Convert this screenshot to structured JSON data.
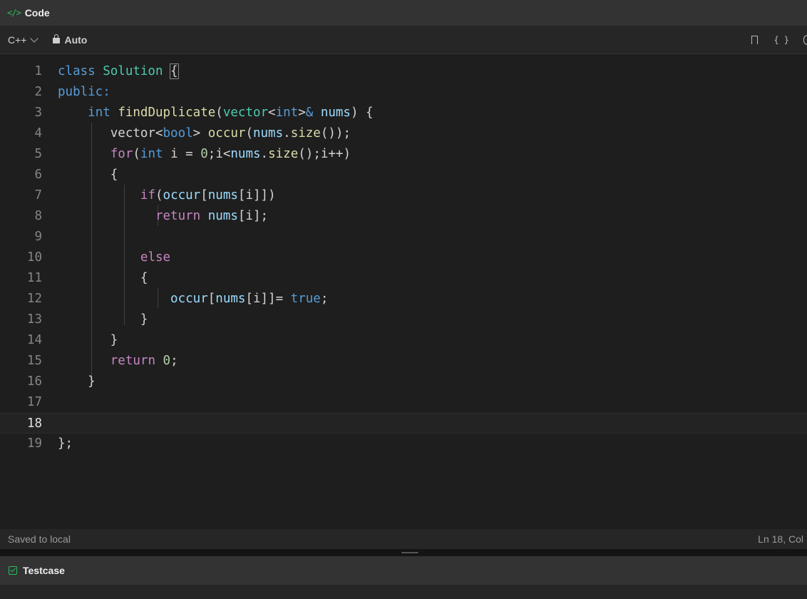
{
  "header": {
    "icon": "code-icon",
    "title": "Code"
  },
  "toolbar": {
    "language": "C++",
    "mode": "Auto"
  },
  "editor": {
    "current_line": 18,
    "lines": [
      {
        "n": "1"
      },
      {
        "n": "2"
      },
      {
        "n": "3"
      },
      {
        "n": "4"
      },
      {
        "n": "5"
      },
      {
        "n": "6"
      },
      {
        "n": "7"
      },
      {
        "n": "8"
      },
      {
        "n": "9"
      },
      {
        "n": "10"
      },
      {
        "n": "11"
      },
      {
        "n": "12"
      },
      {
        "n": "13"
      },
      {
        "n": "14"
      },
      {
        "n": "15"
      },
      {
        "n": "16"
      },
      {
        "n": "17"
      },
      {
        "n": "18"
      },
      {
        "n": "19"
      }
    ],
    "code": [
      [
        [
          "kw",
          "class "
        ],
        [
          "ty",
          "Solution "
        ],
        [
          "pl",
          "{"
        ]
      ],
      [
        [
          "kw",
          "public:"
        ]
      ],
      [
        [
          "pl",
          "    "
        ],
        [
          "kw",
          "int "
        ],
        [
          "fn",
          "findDuplicate"
        ],
        [
          "pl",
          "("
        ],
        [
          "ty",
          "vector"
        ],
        [
          "pl",
          "<"
        ],
        [
          "kw",
          "int"
        ],
        [
          "pl",
          ">"
        ],
        [
          "kw",
          "& "
        ],
        [
          "id",
          "nums"
        ],
        [
          "pl",
          ") {"
        ]
      ],
      [
        [
          "pl",
          "       vector<"
        ],
        [
          "kw",
          "bool"
        ],
        [
          "pl",
          "> "
        ],
        [
          "fn",
          "occur"
        ],
        [
          "pl",
          "("
        ],
        [
          "id",
          "nums"
        ],
        [
          "pl",
          "."
        ],
        [
          "fn",
          "size"
        ],
        [
          "pl",
          "());"
        ]
      ],
      [
        [
          "pl",
          "       "
        ],
        [
          "ctl",
          "for"
        ],
        [
          "pl",
          "("
        ],
        [
          "kw",
          "int "
        ],
        [
          "pl",
          "i = "
        ],
        [
          "num",
          "0"
        ],
        [
          "pl",
          ";i<"
        ],
        [
          "id",
          "nums"
        ],
        [
          "pl",
          "."
        ],
        [
          "fn",
          "size"
        ],
        [
          "pl",
          "();i++)"
        ]
      ],
      [
        [
          "pl",
          "       {"
        ]
      ],
      [
        [
          "pl",
          "           "
        ],
        [
          "ctl",
          "if"
        ],
        [
          "pl",
          "("
        ],
        [
          "id",
          "occur"
        ],
        [
          "pl",
          "["
        ],
        [
          "id",
          "nums"
        ],
        [
          "pl",
          "[i]])"
        ]
      ],
      [
        [
          "pl",
          "             "
        ],
        [
          "ctl",
          "return "
        ],
        [
          "id",
          "nums"
        ],
        [
          "pl",
          "[i];"
        ]
      ],
      [],
      [
        [
          "pl",
          "           "
        ],
        [
          "ctl",
          "else"
        ]
      ],
      [
        [
          "pl",
          "           {"
        ]
      ],
      [
        [
          "pl",
          "               "
        ],
        [
          "id",
          "occur"
        ],
        [
          "pl",
          "["
        ],
        [
          "id",
          "nums"
        ],
        [
          "pl",
          "[i]]= "
        ],
        [
          "kw",
          "true"
        ],
        [
          "pl",
          ";"
        ]
      ],
      [
        [
          "pl",
          "           }"
        ]
      ],
      [
        [
          "pl",
          "       }"
        ]
      ],
      [
        [
          "pl",
          "       "
        ],
        [
          "ctl",
          "return "
        ],
        [
          "num",
          "0"
        ],
        [
          "pl",
          ";"
        ]
      ],
      [
        [
          "pl",
          "    }"
        ]
      ],
      [],
      [],
      [
        [
          "pl",
          "};"
        ]
      ]
    ]
  },
  "status": {
    "saved": "Saved to local",
    "cursor": "Ln 18, Col"
  },
  "testcase": {
    "icon": "checkbox-icon",
    "title": "Testcase"
  }
}
